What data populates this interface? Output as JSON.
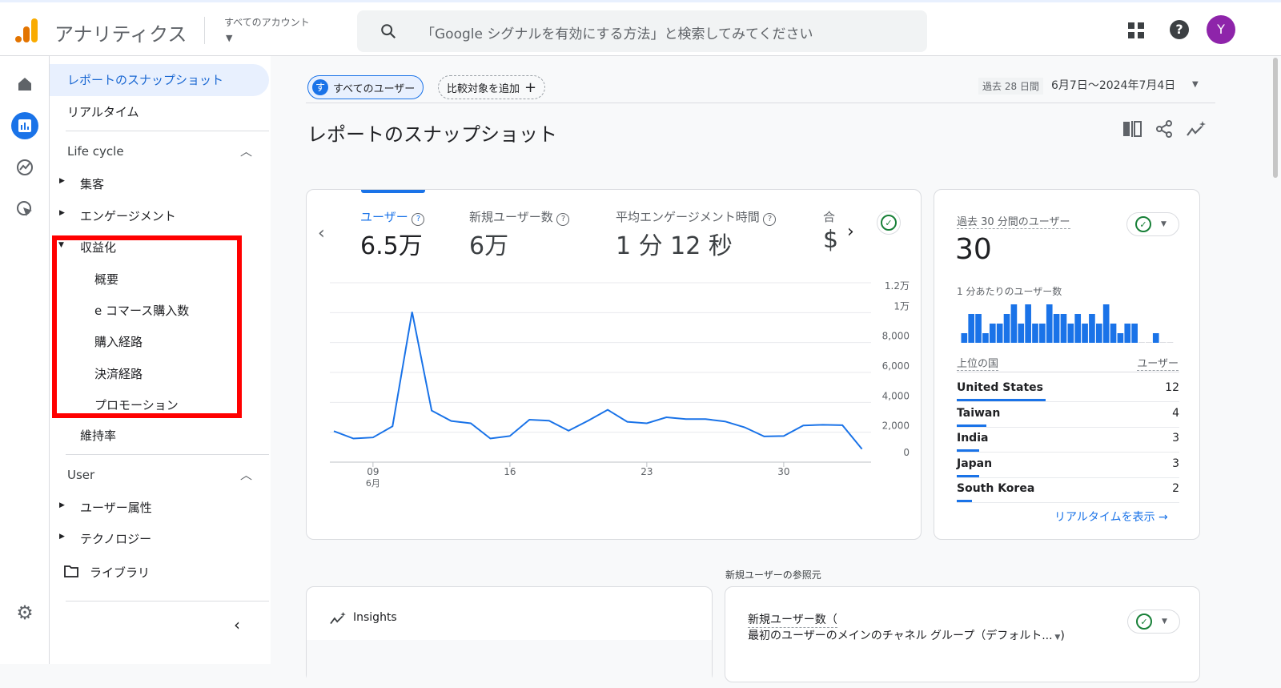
{
  "app": {
    "title": "アナリティクス",
    "account_label": "すべてのアカウント",
    "search_placeholder": "「Google シグナルを有効にする方法」と検索してみてください",
    "avatar_letter": "Y",
    "accent": "#1a73e8"
  },
  "nav": {
    "items": [
      {
        "label": "レポートのスナップショット",
        "selected": true
      },
      {
        "label": "リアルタイム"
      },
      {
        "label": "Life cycle",
        "section": true
      },
      {
        "label": "集客"
      },
      {
        "label": "エンゲージメント"
      },
      {
        "label": "収益化",
        "expanded": true
      },
      {
        "label": "概要"
      },
      {
        "label": "e コマース購入数"
      },
      {
        "label": "購入経路"
      },
      {
        "label": "決済経路"
      },
      {
        "label": "プロモーション"
      },
      {
        "label": "維持率"
      },
      {
        "label": "User",
        "section": true
      },
      {
        "label": "ユーザー属性"
      },
      {
        "label": "テクノロジー"
      },
      {
        "label": "ライブラリ"
      }
    ]
  },
  "filters": {
    "segment_initial": "す",
    "segment": "すべてのユーザー",
    "add_compare": "比較対象を追加"
  },
  "date": {
    "badge": "過去 28 日間",
    "range": "6月7日～2024年7月4日"
  },
  "page_title": "レポートのスナップショット",
  "metrics": [
    {
      "label": "ユーザー",
      "value": "6.5万",
      "active": true
    },
    {
      "label": "新規ユーザー数",
      "value": "6万"
    },
    {
      "label": "平均エンゲージメント時間",
      "value": "1 分 12 秒"
    },
    {
      "label": "合",
      "value": "$"
    }
  ],
  "chart_data": {
    "type": "line",
    "x": [
      "06-07",
      "06-08",
      "06-09",
      "06-10",
      "06-11",
      "06-12",
      "06-13",
      "06-14",
      "06-15",
      "06-16",
      "06-17",
      "06-18",
      "06-19",
      "06-20",
      "06-21",
      "06-22",
      "06-23",
      "06-24",
      "06-25",
      "06-26",
      "06-27",
      "06-28",
      "06-29",
      "06-30",
      "07-01",
      "07-02",
      "07-03",
      "07-04"
    ],
    "series": [
      {
        "values": [
          2070,
          1580,
          1650,
          2400,
          10050,
          3450,
          2750,
          2600,
          1580,
          1750,
          2840,
          2770,
          2100,
          2770,
          3500,
          2700,
          2600,
          3000,
          2880,
          2880,
          2720,
          2330,
          1720,
          1750,
          2450,
          2500,
          2470,
          880
        ],
        "color": "#1a73e8"
      }
    ],
    "ylim": [
      0,
      12000
    ],
    "yticks": [
      "0",
      "2,000",
      "4,000",
      "6,000",
      "8,000",
      "1万",
      "1.2万"
    ],
    "xticks": [
      {
        "label": "09",
        "sub": "6月"
      },
      {
        "label": "16"
      },
      {
        "label": "23"
      },
      {
        "label": "30"
      }
    ],
    "grid": true,
    "y_axis_side": "right"
  },
  "realtime": {
    "title": "過去 30 分間のユーザー",
    "value": "30",
    "per_minute_label": "1 分あたりのユーザー数",
    "per_minute": [
      1,
      3,
      3,
      1,
      2,
      2,
      3,
      4,
      2,
      4,
      2,
      2,
      4,
      3,
      3,
      2,
      3,
      2,
      3,
      2,
      4,
      2,
      1,
      2,
      2,
      0,
      0,
      1,
      0,
      0
    ],
    "country_header": "上位の国",
    "users_header": "ユーザー",
    "countries": [
      {
        "name": "United States",
        "users": "12"
      },
      {
        "name": "Taiwan",
        "users": "4"
      },
      {
        "name": "India",
        "users": "3"
      },
      {
        "name": "Japan",
        "users": "3"
      },
      {
        "name": "South Korea",
        "users": "2"
      }
    ],
    "link": "リアルタイムを表示"
  },
  "insights": {
    "title": "Insights"
  },
  "new_users": {
    "section_title": "新規ユーザーの参照元",
    "card_title": "新規ユーザー数（",
    "card_subtitle": "最初のユーザーのメインのチャネル グループ（デフォルト..."
  }
}
